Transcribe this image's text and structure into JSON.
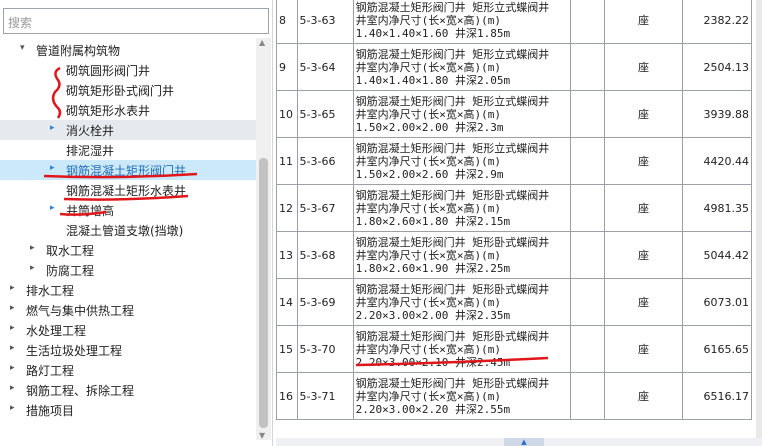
{
  "search": {
    "placeholder": "搜索"
  },
  "tree": [
    {
      "label": "管道附属构筑物",
      "arrow": "▾",
      "indent": 36
    },
    {
      "label": "砌筑圆形阀门井",
      "arrow": "",
      "indent": 66
    },
    {
      "label": "砌筑矩形卧式阀门井",
      "arrow": "",
      "indent": 66
    },
    {
      "label": "砌筑矩形水表井",
      "arrow": "",
      "indent": 66
    },
    {
      "label": "消火栓井",
      "arrow": "▸",
      "indent": 66
    },
    {
      "label": "排泥湿井",
      "arrow": "",
      "indent": 66
    },
    {
      "label": "钢筋混凝土矩形阀门井",
      "arrow": "▸",
      "indent": 66
    },
    {
      "label": "钢筋混凝土矩形水表井",
      "arrow": "",
      "indent": 66
    },
    {
      "label": "井筒增高",
      "arrow": "▸",
      "indent": 66
    },
    {
      "label": "混凝土管道支墩(挡墩)",
      "arrow": "",
      "indent": 66
    },
    {
      "label": "取水工程",
      "arrow": "▸",
      "indent": 46
    },
    {
      "label": "防腐工程",
      "arrow": "▸",
      "indent": 46
    },
    {
      "label": "排水工程",
      "arrow": "▸",
      "indent": 26
    },
    {
      "label": "燃气与集中供热工程",
      "arrow": "▸",
      "indent": 26
    },
    {
      "label": "水处理工程",
      "arrow": "▸",
      "indent": 26
    },
    {
      "label": "生活垃圾处理工程",
      "arrow": "▸",
      "indent": 26
    },
    {
      "label": "路灯工程",
      "arrow": "▸",
      "indent": 26
    },
    {
      "label": "钢筋工程、拆除工程",
      "arrow": "▸",
      "indent": 26
    },
    {
      "label": "措施项目",
      "arrow": "▸",
      "indent": 26
    }
  ],
  "rows": [
    {
      "idx": "8",
      "code": "5-3-63",
      "l1": "钢筋混凝土矩形阀门井 矩形立式蝶阀井",
      "l2": "井室内净尺寸(长×宽×高)(m)",
      "l3": "1.40×1.40×1.60 井深1.85m",
      "unit": "座",
      "value": "2382.22"
    },
    {
      "idx": "9",
      "code": "5-3-64",
      "l1": "钢筋混凝土矩形阀门井 矩形立式蝶阀井",
      "l2": "井室内净尺寸(长×宽×高)(m)",
      "l3": "1.40×1.40×1.80 井深2.05m",
      "unit": "座",
      "value": "2504.13"
    },
    {
      "idx": "10",
      "code": "5-3-65",
      "l1": "钢筋混凝土矩形阀门井 矩形立式蝶阀井",
      "l2": "井室内净尺寸(长×宽×高)(m)",
      "l3": "1.50×2.00×2.00 井深2.3m",
      "unit": "座",
      "value": "3939.88"
    },
    {
      "idx": "11",
      "code": "5-3-66",
      "l1": "钢筋混凝土矩形阀门井 矩形立式蝶阀井",
      "l2": "井室内净尺寸(长×宽×高)(m)",
      "l3": "1.50×2.00×2.60 井深2.9m",
      "unit": "座",
      "value": "4420.44"
    },
    {
      "idx": "12",
      "code": "5-3-67",
      "l1": "钢筋混凝土矩形阀门井 矩形卧式蝶阀井",
      "l2": "井室内净尺寸(长×宽×高)(m)",
      "l3": "1.80×2.60×1.80 井深2.15m",
      "unit": "座",
      "value": "4981.35"
    },
    {
      "idx": "13",
      "code": "5-3-68",
      "l1": "钢筋混凝土矩形阀门井 矩形卧式蝶阀井",
      "l2": "井室内净尺寸(长×宽×高)(m)",
      "l3": "1.80×2.60×1.90 井深2.25m",
      "unit": "座",
      "value": "5044.42"
    },
    {
      "idx": "14",
      "code": "5-3-69",
      "l1": "钢筋混凝土矩形阀门井 矩形卧式蝶阀井",
      "l2": "井室内净尺寸(长×宽×高)(m)",
      "l3": "2.20×3.00×2.00 井深2.35m",
      "unit": "座",
      "value": "6073.01"
    },
    {
      "idx": "15",
      "code": "5-3-70",
      "l1": "钢筋混凝土矩形阀门井 矩形卧式蝶阀井",
      "l2": "井室内净尺寸(长×宽×高)(m)",
      "l3": "2.20×3.00×2.10 井深2.45m",
      "unit": "座",
      "value": "6165.65"
    },
    {
      "idx": "16",
      "code": "5-3-71",
      "l1": "钢筋混凝土矩形阀门井 矩形卧式蝶阀井",
      "l2": "井室内净尺寸(长×宽×高)(m)",
      "l3": "2.20×3.00×2.20 井深2.55m",
      "unit": "座",
      "value": "6516.17"
    }
  ],
  "colors": {
    "selected_bg": "#cce8fb",
    "annotation_red": "#e0161b",
    "link_blue": "#1f6fb8"
  }
}
